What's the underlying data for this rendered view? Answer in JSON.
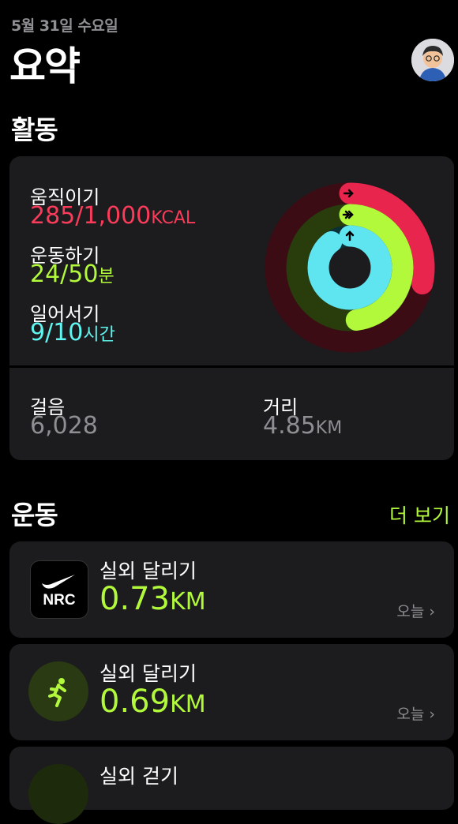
{
  "header": {
    "date": "5월 31일 수요일",
    "title": "요약"
  },
  "activity": {
    "section_title": "활동",
    "move": {
      "label": "움직이기",
      "value": "285/1,000",
      "unit": "KCAL",
      "progress": 0.285,
      "color": "#fa114f"
    },
    "exercise": {
      "label": "운동하기",
      "value": "24/50",
      "unit": "분",
      "progress": 0.48,
      "color": "#a6ff00"
    },
    "stand": {
      "label": "일어서기",
      "value": "9/10",
      "unit": "시간",
      "progress": 0.9,
      "color": "#00f0ff"
    },
    "steps": {
      "label": "걸음",
      "value": "6,028"
    },
    "distance": {
      "label": "거리",
      "value": "4.85",
      "unit": "KM"
    }
  },
  "workouts": {
    "section_title": "운동",
    "more_label": "더 보기",
    "items": [
      {
        "title": "실외 달리기",
        "value": "0.73",
        "unit": "KM",
        "day": "오늘",
        "icon": "nrc-logo",
        "logo_text": "NRC"
      },
      {
        "title": "실외 달리기",
        "value": "0.69",
        "unit": "KM",
        "day": "오늘",
        "icon": "runner-icon"
      },
      {
        "title": "실외 걷기"
      }
    ]
  }
}
